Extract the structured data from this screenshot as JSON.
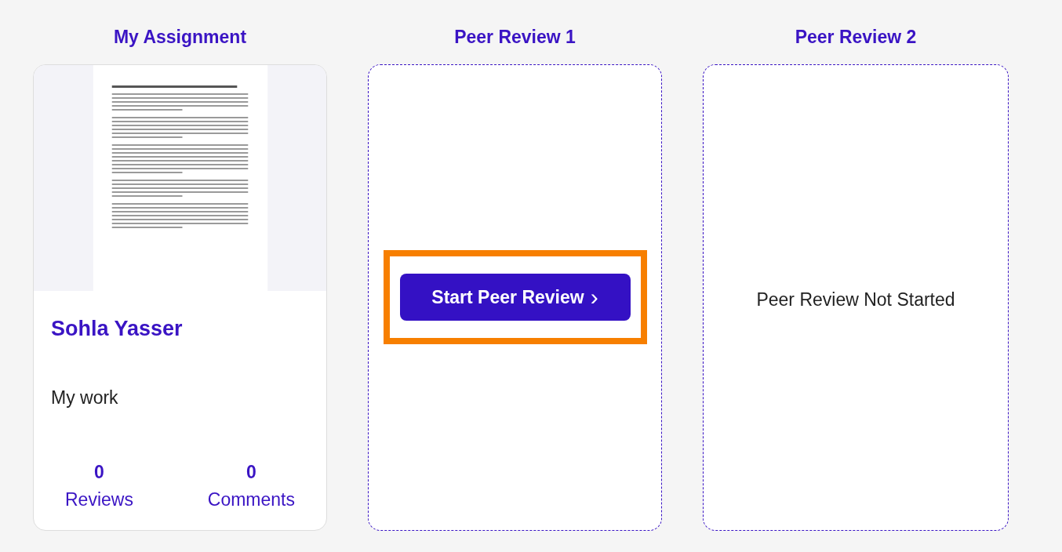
{
  "columns": [
    {
      "heading": "My Assignment",
      "kind": "submission",
      "card": {
        "author": "Sohla Yasser",
        "description": "My work",
        "stats": [
          {
            "value": "0",
            "label": "Reviews"
          },
          {
            "value": "0",
            "label": "Comments"
          }
        ]
      }
    },
    {
      "heading": "Peer Review 1",
      "kind": "action",
      "card": {
        "button": {
          "label": "Start Peer Review",
          "icon": "›",
          "highlighted": true
        }
      }
    },
    {
      "heading": "Peer Review 2",
      "kind": "status",
      "card": {
        "status": "Peer Review Not Started"
      }
    }
  ]
}
